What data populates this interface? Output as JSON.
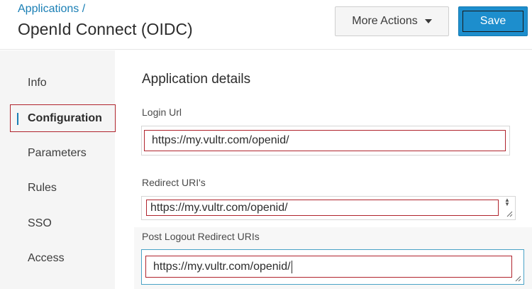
{
  "header": {
    "breadcrumb": "Applications /",
    "title": "OpenId Connect (OIDC)",
    "more_actions_label": "More Actions",
    "save_label": "Save"
  },
  "sidebar": {
    "items": [
      {
        "label": "Info"
      },
      {
        "label": "Configuration",
        "active": true
      },
      {
        "label": "Parameters"
      },
      {
        "label": "Rules"
      },
      {
        "label": "SSO"
      },
      {
        "label": "Access"
      }
    ]
  },
  "main": {
    "section_title": "Application details",
    "fields": [
      {
        "label": "Login Url",
        "value": "https://my.vultr.com/openid/"
      },
      {
        "label": "Redirect URI's",
        "value": "https://my.vultr.com/openid/"
      },
      {
        "label": "Post Logout Redirect URIs",
        "value": "https://my.vultr.com/openid/"
      }
    ]
  },
  "colors": {
    "accent": "#1d8ecd",
    "highlight_border": "#b0242d",
    "sidebar_bg": "#f5f5f5"
  }
}
